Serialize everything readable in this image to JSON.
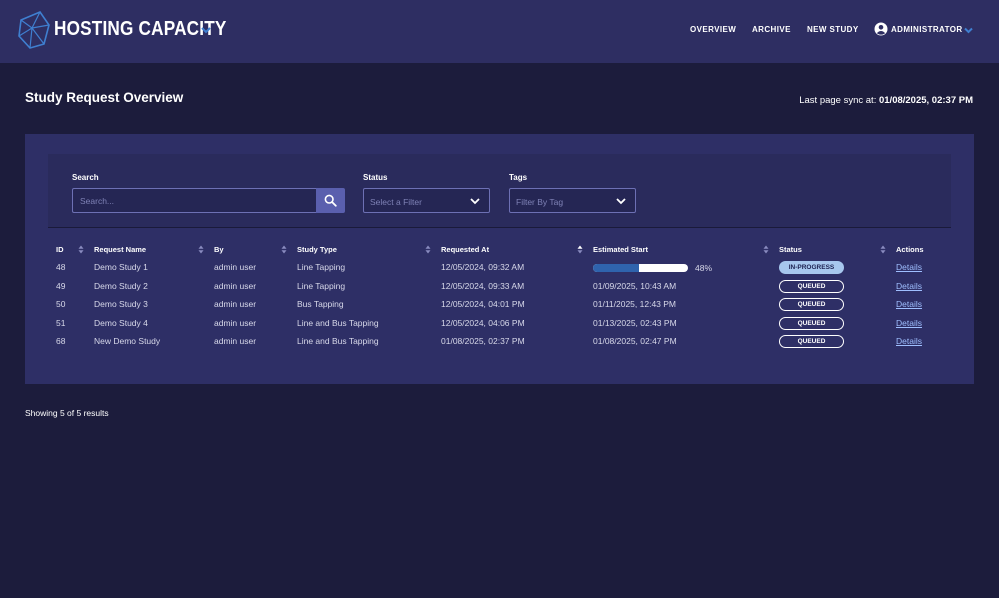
{
  "header": {
    "brand": "HOSTING CAPACITY",
    "nav": [
      "OVERVIEW",
      "ARCHIVE",
      "NEW STUDY"
    ],
    "user": "ADMINISTRATOR",
    "icons": [
      "logo-icon",
      "chevron-down-icon",
      "user-circle-icon"
    ]
  },
  "page": {
    "title": "Study Request Overview",
    "sync_label": "Last page sync at: ",
    "sync_value": "01/08/2025, 02:37 PM"
  },
  "filters": {
    "search_label": "Search",
    "search_placeholder": "Search...",
    "status_label": "Status",
    "status_placeholder": "Select a Filter",
    "tags_label": "Tags",
    "tags_placeholder": "Filter By Tag"
  },
  "table": {
    "columns": [
      "ID",
      "Request Name",
      "By",
      "Study Type",
      "Requested At",
      "Estimated Start",
      "Status",
      "Actions"
    ],
    "rows": [
      {
        "id": "48",
        "name": "Demo Study 1",
        "by": "admin user",
        "type": "Line Tapping",
        "requested": "12/05/2024, 09:32 AM",
        "estimated": "",
        "progress": 0.48,
        "progress_label": "48%",
        "status": "IN-PROGRESS",
        "action": "Details"
      },
      {
        "id": "49",
        "name": "Demo Study 2",
        "by": "admin user",
        "type": "Line Tapping",
        "requested": "12/05/2024, 09:33 AM",
        "estimated": "01/09/2025, 10:43 AM",
        "status": "QUEUED",
        "action": "Details"
      },
      {
        "id": "50",
        "name": "Demo Study 3",
        "by": "admin user",
        "type": "Bus Tapping",
        "requested": "12/05/2024, 04:01 PM",
        "estimated": "01/11/2025, 12:43 PM",
        "status": "QUEUED",
        "action": "Details"
      },
      {
        "id": "51",
        "name": "Demo Study 4",
        "by": "admin user",
        "type": "Line and Bus Tapping",
        "requested": "12/05/2024, 04:06 PM",
        "estimated": "01/13/2025, 02:43 PM",
        "status": "QUEUED",
        "action": "Details"
      },
      {
        "id": "68",
        "name": "New Demo Study",
        "by": "admin user",
        "type": "Line and Bus Tapping",
        "requested": "01/08/2025, 02:37 PM",
        "estimated": "01/08/2025, 02:47 PM",
        "status": "QUEUED",
        "action": "Details"
      }
    ]
  },
  "footer": {
    "results": "Showing 5 of 5 results"
  },
  "colors": {
    "background": "#1c1c3c",
    "header": "#2e2e62",
    "panel": "#2e2f66",
    "accent": "#3f7fd0",
    "link": "#9fbfff",
    "progress": "#2f63ad"
  }
}
